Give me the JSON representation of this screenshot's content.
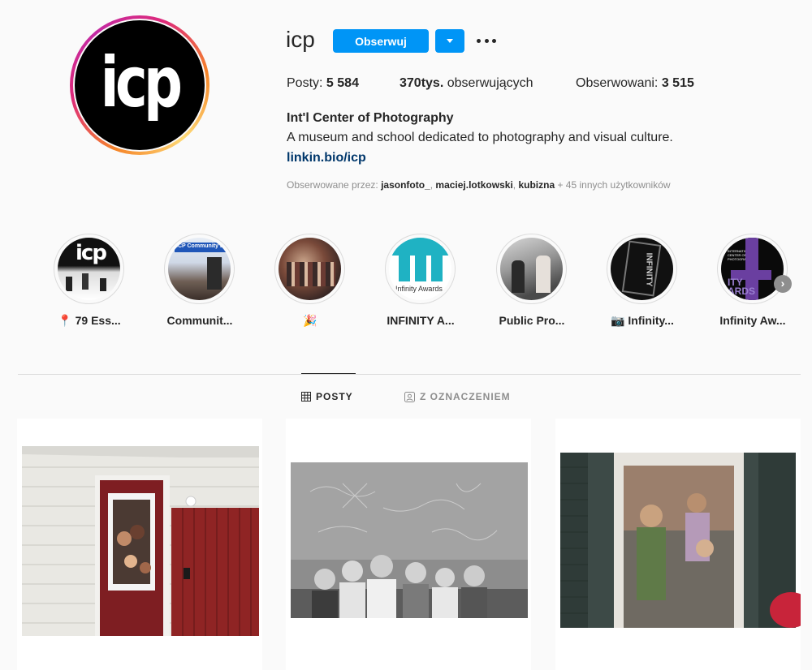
{
  "profile": {
    "username": "icp",
    "avatar_text": "icp",
    "follow_label": "Obserwuj",
    "stats": {
      "posts_label": "Posty:",
      "posts_value": "5 584",
      "followers_value": "370tys.",
      "followers_label": "obserwujących",
      "following_label": "Obserwowani:",
      "following_value": "3 515"
    },
    "full_name": "Int'l Center of Photography",
    "bio": "A museum and school dedicated to photography and visual culture.",
    "link": "linkin.bio/icp",
    "followed_by": {
      "prefix": "Obserwowane przez:",
      "users": [
        "jasonfoto_",
        "maciej.lotkowski",
        "kubizna"
      ],
      "suffix": "+ 45 innych użytkowników"
    }
  },
  "highlights": [
    {
      "label": "📍 79 Ess..."
    },
    {
      "label": "Communit..."
    },
    {
      "label": "🎉"
    },
    {
      "label": "INFINITY A..."
    },
    {
      "label": "Public Pro..."
    },
    {
      "label": "📷 Infinity..."
    },
    {
      "label": "Infinity Aw..."
    }
  ],
  "highlight_texts": {
    "icp_thumb": "icp",
    "community": "ICP Community Day",
    "infinity_awards": "Infinity Awards",
    "infinity_vertical": "INFINITY",
    "icp_small": "INTERNATIONAL CENTER OF PHOTOGRAPHY",
    "ty_awards": "ITY ARDS"
  },
  "tabs": {
    "posts": "POSTY",
    "tagged": "Z OZNACZENIEM"
  },
  "icons": {
    "grid": "grid-icon",
    "tagged": "tagged-icon",
    "more": "more-options-icon",
    "dropdown": "chevron-down-icon",
    "next": "chevron-right-icon"
  },
  "colors": {
    "accent": "#0095f6",
    "link": "#00376b",
    "muted": "#8e8e8e"
  }
}
